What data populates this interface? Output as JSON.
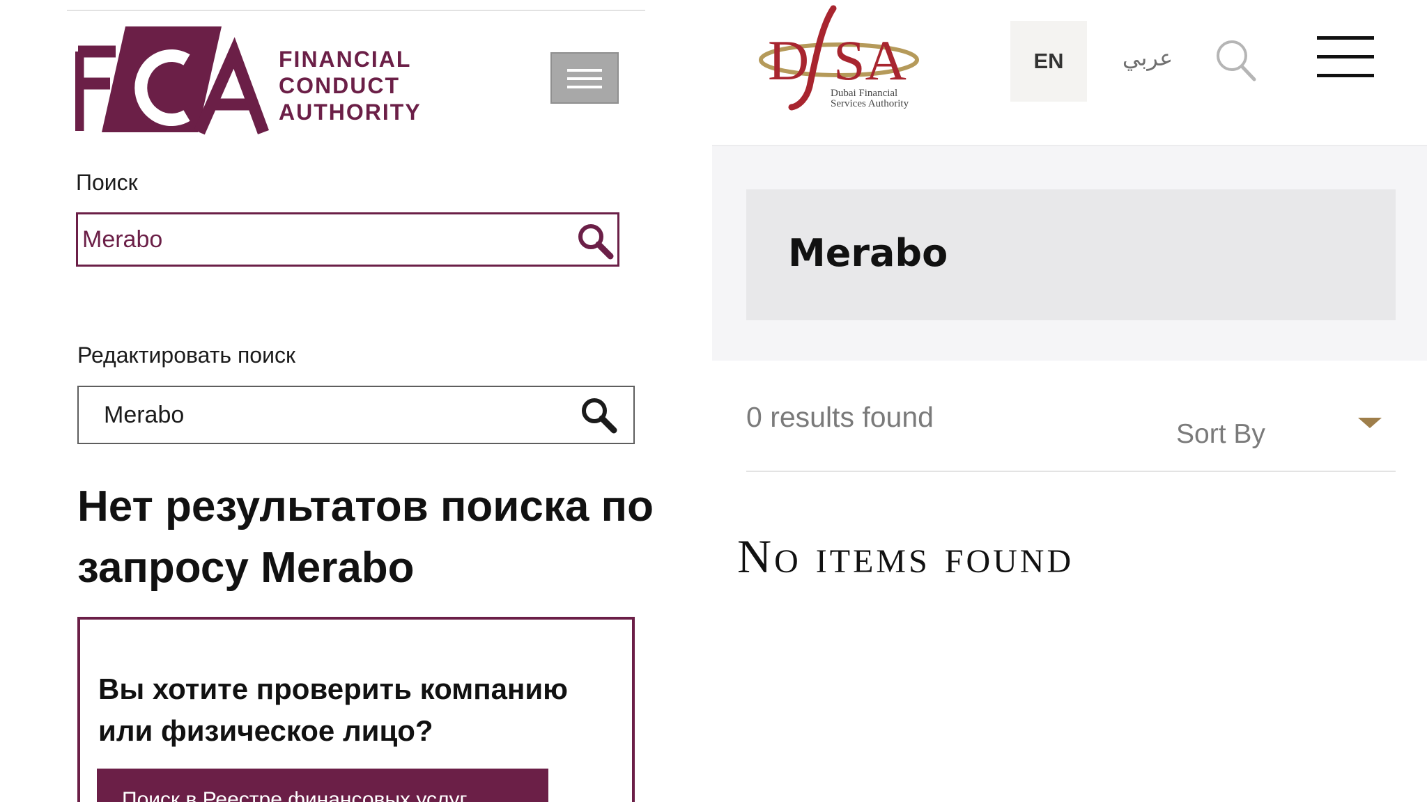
{
  "fca": {
    "logo": {
      "letters": "FCA",
      "line1": "FINANCIAL",
      "line2": "CONDUCT",
      "line3": "AUTHORITY",
      "color": "#6b1f47"
    },
    "search_label": "Поиск",
    "search_value": "Merabo",
    "edit_search_label": "Редактировать поиск",
    "edit_search_value": "Merabo",
    "no_results_prefix": "Нет результатов поиска по запросу",
    "no_results_query": "Merabo",
    "check_prompt": "Вы хотите проверить компанию или физическое лицо?",
    "register_button": "Поиск в Реестре финансовых услуг",
    "icons": [
      "menu-icon",
      "search-icon"
    ]
  },
  "dfsa": {
    "logo": {
      "mark": "DFSA",
      "line1": "Dubai Financial",
      "line2": "Services Authority"
    },
    "lang_en": "EN",
    "lang_ar": "عربي",
    "page_title": "Merabo",
    "results_count": "0 results found",
    "sort_label": "Sort By",
    "no_items": "No items found",
    "accent_color": "#9e7e4a",
    "icons": [
      "search-icon",
      "hamburger-menu-icon",
      "caret-down-icon"
    ]
  }
}
